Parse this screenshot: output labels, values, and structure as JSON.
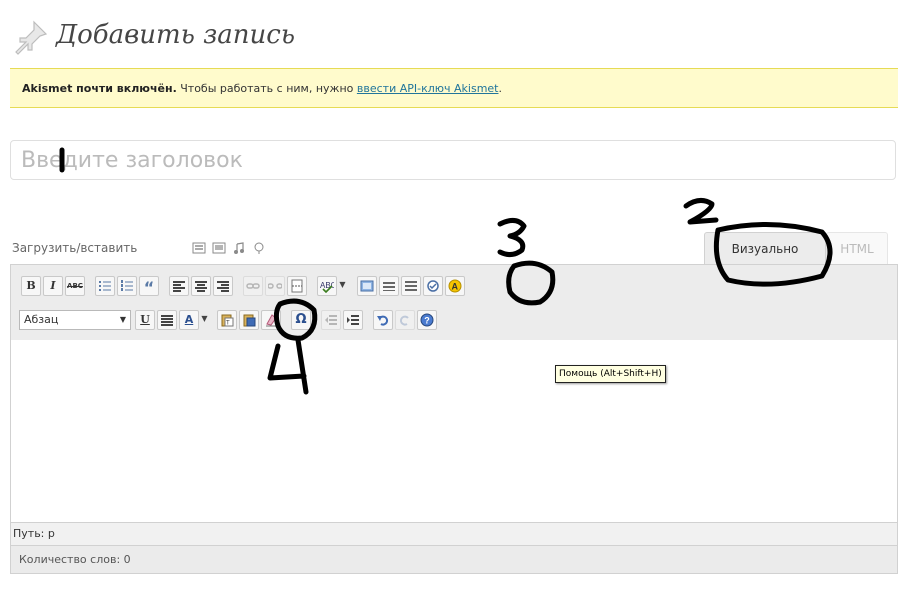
{
  "header": {
    "title": "Добавить запись",
    "icon": "pushpin-icon"
  },
  "notice": {
    "bold": "Akismet почти включён.",
    "text": " Чтобы работать с ним, нужно ",
    "link": "ввести API-ключ Akismet",
    "end": "."
  },
  "title_input": {
    "placeholder": "Введите заголовок",
    "value": ""
  },
  "media": {
    "label": "Загрузить/вставить",
    "icons": [
      "image-icon",
      "video-icon",
      "audio-icon",
      "media-icon"
    ]
  },
  "tabs": {
    "visual": "Визуально",
    "html": "HTML"
  },
  "toolbar": {
    "bold": "B",
    "italic": "I",
    "strike": "ABC",
    "quote": "“",
    "underline": "U",
    "text_color": "A",
    "omega": "Ω",
    "format_select": "Абзац"
  },
  "tooltip": "Помощь (Alt+Shift+H)",
  "path": "Путь: p",
  "word_count": "Количество слов: 0",
  "annotations": [
    "1",
    "2",
    "3",
    "4"
  ],
  "colors": {
    "notice_bg": "#fffbcc",
    "link": "#21759b",
    "toolbar_bg": "#ececec"
  }
}
